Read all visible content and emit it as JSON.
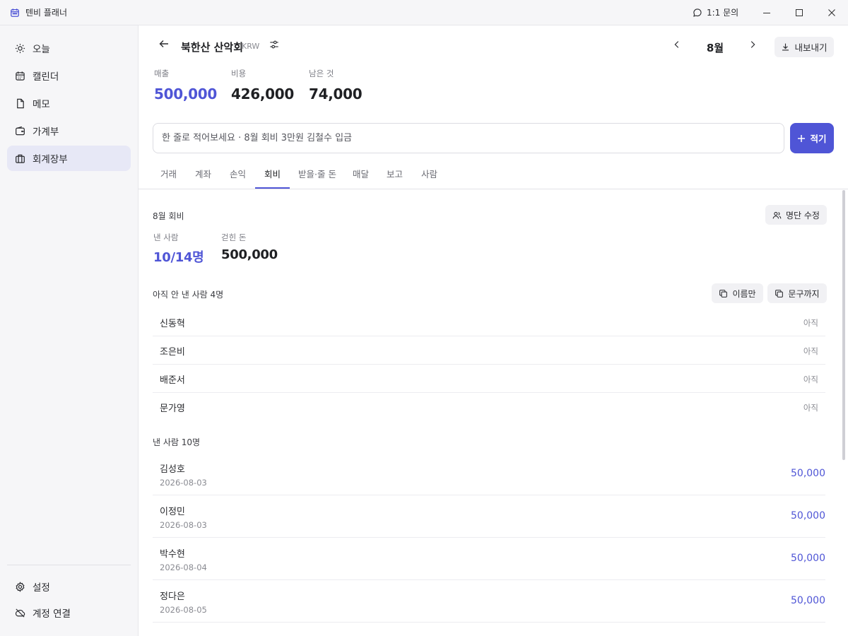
{
  "titlebar": {
    "app_name": "텐비 플래너",
    "support_label": "1:1 문의"
  },
  "sidebar": {
    "items": [
      {
        "label": "오늘",
        "icon": "sun-icon"
      },
      {
        "label": "캘린더",
        "icon": "calendar-icon"
      },
      {
        "label": "메모",
        "icon": "note-icon"
      },
      {
        "label": "가계부",
        "icon": "wallet-icon"
      },
      {
        "label": "회계장부",
        "icon": "briefcase-icon",
        "active": true
      }
    ],
    "bottom": [
      {
        "label": "설정",
        "icon": "gear-icon"
      },
      {
        "label": "계정 연결",
        "icon": "cloud-off-icon"
      }
    ]
  },
  "header": {
    "title": "북한산 산악회",
    "currency": "KRW",
    "month": "8월",
    "export_label": "내보내기"
  },
  "stats": [
    {
      "label": "매출",
      "value": "500,000",
      "color": "#4f55d6"
    },
    {
      "label": "비용",
      "value": "426,000",
      "color": "#1f2023"
    },
    {
      "label": "남은 것",
      "value": "74,000",
      "color": "#1f2023"
    }
  ],
  "quick_entry": {
    "placeholder": "한 줄로 적어보세요 · 8월 회비 3만원 김철수 입금",
    "button_label": "적기"
  },
  "tabs": [
    "거래",
    "계좌",
    "손익",
    "회비",
    "받을·줄 돈",
    "매달",
    "보고",
    "사람"
  ],
  "active_tab": "회비",
  "dues": {
    "title": "8월 회비",
    "edit_roster_label": "명단 수정",
    "paid_count_label": "낸 사람",
    "paid_count": "10/14명",
    "collected_label": "걷힌 돈",
    "collected": "500,000",
    "unpaid_title": "아직 안 낸 사람 4명",
    "copy_names_label": "이름만",
    "copy_message_label": "문구까지",
    "unpaid": [
      {
        "name": "신동혁",
        "status": "아직"
      },
      {
        "name": "조은비",
        "status": "아직"
      },
      {
        "name": "배준서",
        "status": "아직"
      },
      {
        "name": "문가영",
        "status": "아직"
      }
    ],
    "paid_title": "낸 사람 10명",
    "paid": [
      {
        "name": "김성호",
        "date": "2026-08-03",
        "amount": "50,000"
      },
      {
        "name": "이정민",
        "date": "2026-08-03",
        "amount": "50,000"
      },
      {
        "name": "박수현",
        "date": "2026-08-04",
        "amount": "50,000"
      },
      {
        "name": "정다은",
        "date": "2026-08-05",
        "amount": "50,000"
      }
    ]
  },
  "colors": {
    "accent": "#4f55d6",
    "active_nav_bg": "#e7e8f6",
    "sidebar_bg": "#f6f6f8"
  }
}
